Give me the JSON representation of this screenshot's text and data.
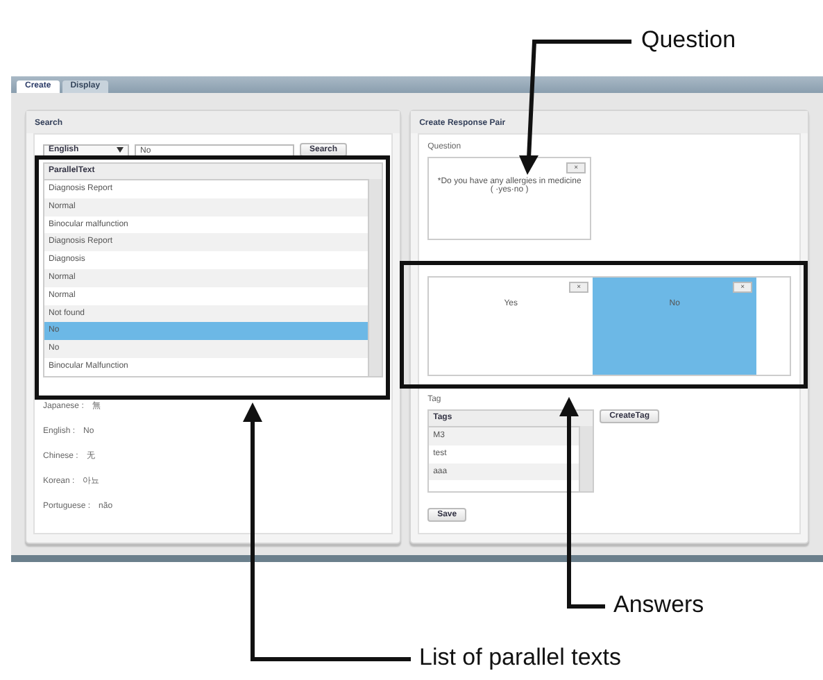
{
  "annotations": [
    {
      "label": "Question"
    },
    {
      "label": "Answers"
    },
    {
      "label": "List of parallel texts"
    }
  ],
  "tabs": [
    {
      "label": "Create",
      "selected": true
    },
    {
      "label": "Display",
      "selected": false
    }
  ],
  "search": {
    "title": "Search",
    "language": "English",
    "value": "No",
    "button": "Search"
  },
  "parallel_list": {
    "header": "ParallelText",
    "rows": [
      {
        "text": "Diagnosis Report",
        "selected": false
      },
      {
        "text": "Normal",
        "selected": false
      },
      {
        "text": "Binocular malfunction",
        "selected": false
      },
      {
        "text": "Diagnosis Report",
        "selected": false
      },
      {
        "text": "Diagnosis",
        "selected": false
      },
      {
        "text": "Normal",
        "selected": false
      },
      {
        "text": "Normal",
        "selected": false
      },
      {
        "text": "Not found",
        "selected": false
      },
      {
        "text": "No",
        "selected": true
      },
      {
        "text": "No",
        "selected": false
      },
      {
        "text": "Binocular Malfunction",
        "selected": false
      }
    ]
  },
  "translations": [
    {
      "language": "Japanese :",
      "text": "無"
    },
    {
      "language": "English :",
      "text": "No"
    },
    {
      "language": "Chinese :",
      "text": "无"
    },
    {
      "language": "Korean :",
      "text": "아뇨"
    },
    {
      "language": "Portuguese :",
      "text": "não"
    }
  ],
  "response_pair": {
    "title": "Create Response Pair",
    "question_label": "Question",
    "question": {
      "text": "*Do you have any allergies in medicine ( ·yes·no )",
      "remove": "×"
    },
    "answers": [
      {
        "text": "Yes",
        "remove": "×",
        "selected": false
      },
      {
        "text": "No",
        "remove": "×",
        "selected": true
      }
    ]
  },
  "tag": {
    "label": "Tag",
    "header": "Tags",
    "rows": [
      "M3",
      "test",
      "aaa"
    ],
    "create_button": "CreateTag"
  },
  "save_button": "Save"
}
